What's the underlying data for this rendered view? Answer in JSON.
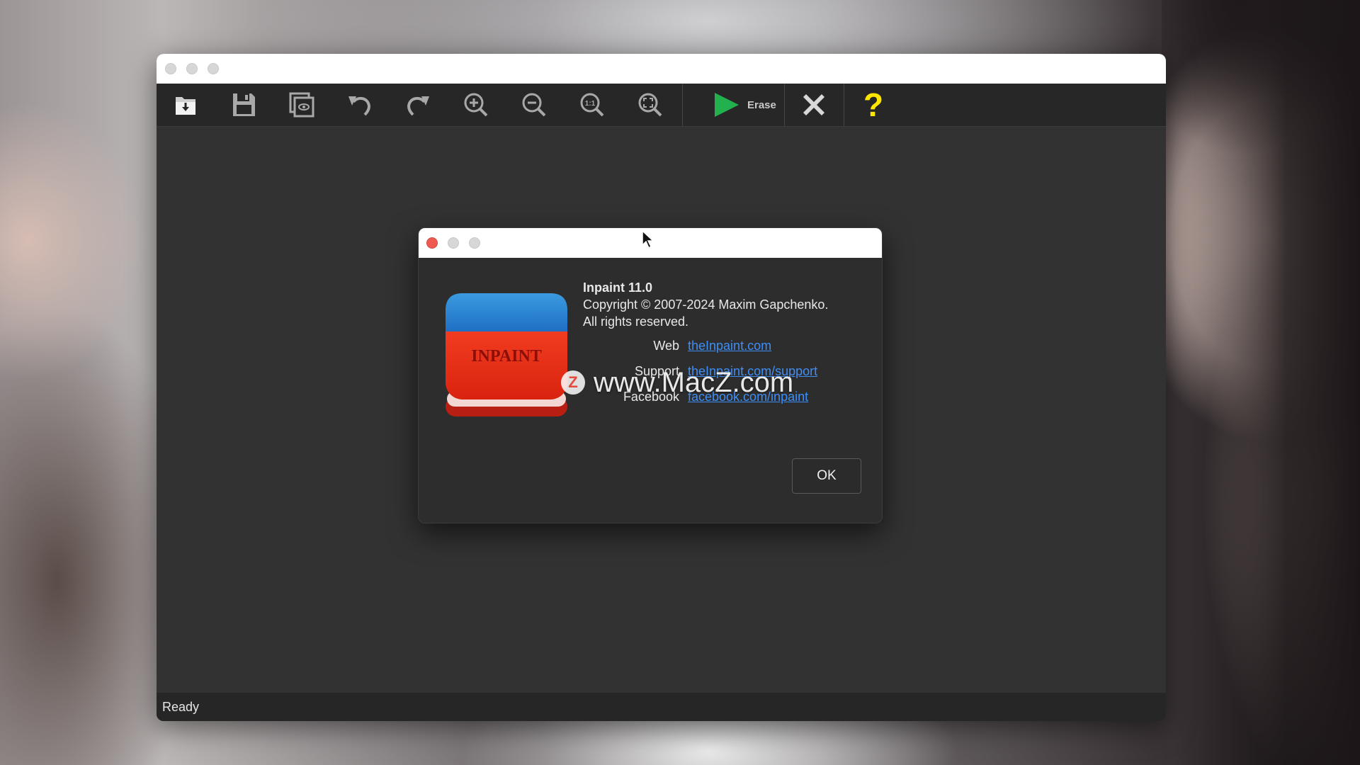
{
  "toolbar": {
    "buttons": [
      {
        "name": "open-button",
        "icon": "open-download-icon"
      },
      {
        "name": "save-button",
        "icon": "save-icon"
      },
      {
        "name": "preview-button",
        "icon": "preview-icon"
      },
      {
        "name": "undo-button",
        "icon": "undo-icon"
      },
      {
        "name": "redo-button",
        "icon": "redo-icon"
      },
      {
        "name": "zoom-in-button",
        "icon": "zoom-in-icon"
      },
      {
        "name": "zoom-out-button",
        "icon": "zoom-out-icon"
      },
      {
        "name": "zoom-actual-button",
        "icon": "zoom-1-1-icon"
      },
      {
        "name": "zoom-fit-button",
        "icon": "zoom-fit-icon"
      }
    ],
    "erase_label": "Erase",
    "zoom_actual_text": "1:1",
    "help_glyph": "?",
    "colors": {
      "play": "#22b14c",
      "help": "#ffe600",
      "close": "#d8d8d8"
    }
  },
  "status": {
    "text": "Ready"
  },
  "about": {
    "icon_text": "INPAINT",
    "title": "Inpaint 11.0",
    "copyright": "Copyright © 2007-2024 Maxim Gapchenko.",
    "rights": "All rights reserved.",
    "links": [
      {
        "label": "Web",
        "text": "theInpaint.com"
      },
      {
        "label": "Support",
        "text": "theInpaint.com/support"
      },
      {
        "label": "Facebook",
        "text": "facebook.com/inpaint"
      }
    ],
    "ok_label": "OK",
    "link_color": "#3e8ef7"
  },
  "watermark": {
    "logo": "Z",
    "text": "www.MacZ.com"
  }
}
